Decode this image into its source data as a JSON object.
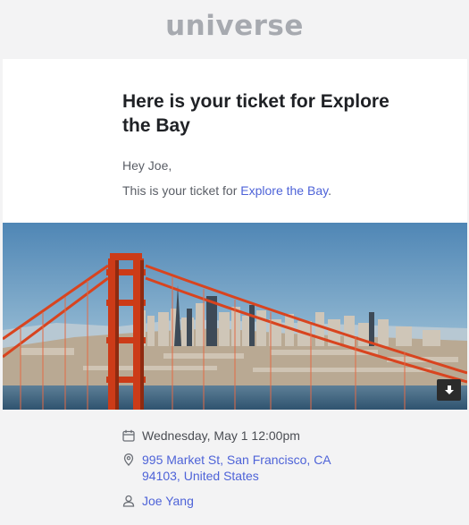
{
  "brand": {
    "logo_text": "universe"
  },
  "email": {
    "headline": "Here is your ticket for Explore the Bay",
    "greeting": "Hey Joe,",
    "intro_prefix": "This is your ticket for ",
    "event_link": "Explore the Bay",
    "intro_suffix": "."
  },
  "hero": {
    "alt": "Golden Gate Bridge and San Francisco skyline",
    "download_icon": "download-icon"
  },
  "details": {
    "datetime": "Wednesday, May 1 12:00pm",
    "address": "995 Market St, San Francisco, CA 94103, United States",
    "attendee": "Joe Yang",
    "icons": {
      "date": "calendar-icon",
      "address": "location-pin-icon",
      "attendee": "user-icon"
    }
  },
  "colors": {
    "link": "#4e63d8",
    "logo": "#a7aab0",
    "heading": "#1f2125",
    "body_text": "#5a5e66",
    "bridge": "#d8441f",
    "page_bg": "#f3f3f4"
  }
}
